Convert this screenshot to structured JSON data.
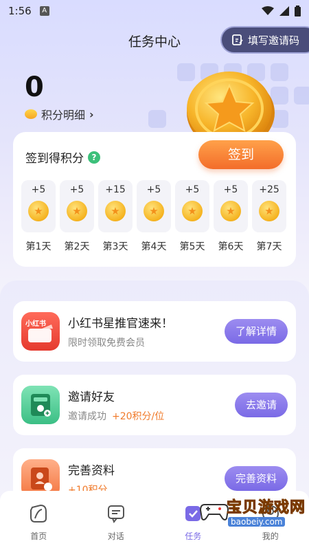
{
  "status_bar": {
    "time": "1:56",
    "notif_glyph": "A"
  },
  "header": {
    "title": "任务中心",
    "invite_label": "填写邀请码"
  },
  "points": {
    "value": "0",
    "detail_label": "积分明细"
  },
  "checkin": {
    "label": "签到得积分",
    "help_glyph": "?",
    "button": "签到",
    "days": [
      {
        "points": "+5",
        "name": "第1天"
      },
      {
        "points": "+5",
        "name": "第2天"
      },
      {
        "points": "+15",
        "name": "第3天"
      },
      {
        "points": "+5",
        "name": "第4天"
      },
      {
        "points": "+5",
        "name": "第5天"
      },
      {
        "points": "+5",
        "name": "第6天"
      },
      {
        "points": "+25",
        "name": "第7天"
      }
    ]
  },
  "tasks": [
    {
      "title": "小红书星推官速来！",
      "sub": "限时领取免费会员",
      "reward": "",
      "button": "了解详情",
      "icon_text": "小红书"
    },
    {
      "title": "邀请好友",
      "sub": "邀请成功",
      "reward": "+20积分/位",
      "button": "去邀请",
      "icon_text": ""
    },
    {
      "title": "完善资料",
      "sub": "",
      "reward": "+10积分",
      "button": "完善资料",
      "icon_text": ""
    }
  ],
  "tabbar": [
    {
      "label": "首页",
      "icon": "leaf-icon"
    },
    {
      "label": "对话",
      "icon": "chat-icon"
    },
    {
      "label": "任务",
      "icon": "task-icon"
    },
    {
      "label": "我的",
      "icon": "profile-icon"
    }
  ],
  "watermark": {
    "text": "宝贝游戏网",
    "url": "baobeiy.com"
  },
  "colors": {
    "accent": "#7a6ae6",
    "orange": "#f36d2a",
    "bg": "#f4f3fb"
  }
}
